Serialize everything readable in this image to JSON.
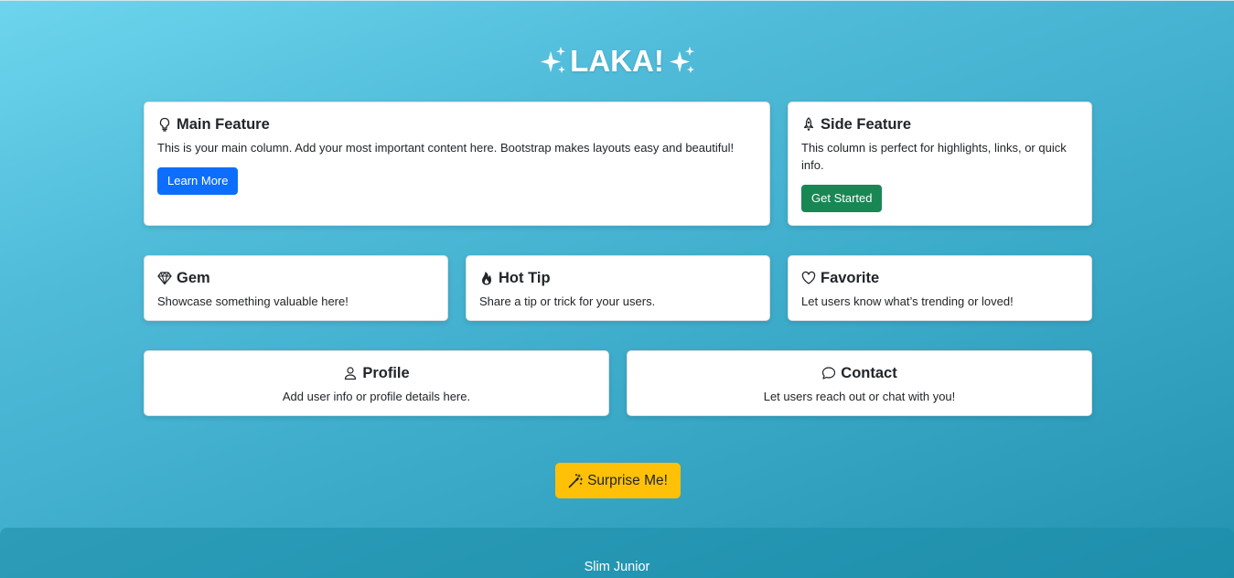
{
  "hero": {
    "title": "LAKA!",
    "icon": "sparkles-icon"
  },
  "main_feature": {
    "icon": "lightbulb-icon",
    "title": "Main Feature",
    "text": "This is your main column. Add your most important content here. Bootstrap makes layouts easy and beautiful!",
    "button_label": "Learn More",
    "button_color": "#0d6efd"
  },
  "side_feature": {
    "icon": "rocket-icon",
    "title": "Side Feature",
    "text": "This column is perfect for highlights, links, or quick info.",
    "button_label": "Get Started",
    "button_color": "#198754"
  },
  "mini_cards": [
    {
      "icon": "gem-icon",
      "title": "Gem",
      "text": "Showcase something valuable here!"
    },
    {
      "icon": "fire-icon",
      "title": "Hot Tip",
      "text": "Share a tip or trick for your users."
    },
    {
      "icon": "heart-icon",
      "title": "Favorite",
      "text": "Let users know what’s trending or loved!"
    }
  ],
  "wide_cards": [
    {
      "icon": "person-icon",
      "title": "Profile",
      "text": "Add user info or profile details here."
    },
    {
      "icon": "chat-icon",
      "title": "Contact",
      "text": "Let users reach out or chat with you!"
    }
  ],
  "surprise_button": {
    "icon": "magic-wand-icon",
    "label": "Surprise Me!",
    "color": "#ffc107"
  },
  "footer": {
    "text": "Slim Junior"
  },
  "colors": {
    "gradient_start": "#6dd5ed",
    "gradient_end": "#2292b0"
  }
}
